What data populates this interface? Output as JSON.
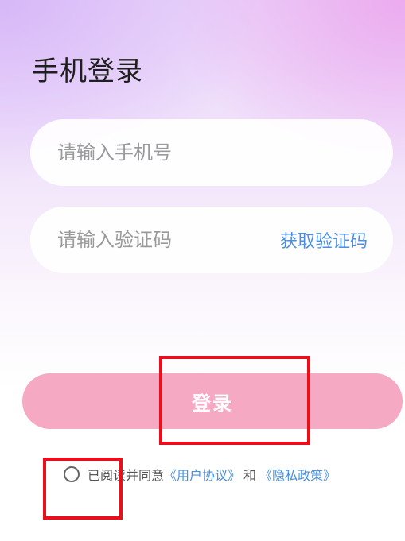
{
  "header": {
    "title": "手机登录"
  },
  "form": {
    "phone_placeholder": "请输入手机号",
    "code_placeholder": "请输入验证码",
    "get_code_label": "获取验证码",
    "login_label": "登录"
  },
  "agreement": {
    "prefix": "已阅读并同意",
    "user_agreement": "《用户协议》",
    "conjunction": "和",
    "privacy_policy": "《隐私政策》",
    "checked": false
  },
  "colors": {
    "accent_link": "#4a8fe0",
    "login_button": "#f5a9c3",
    "highlight_box": "#e8101c"
  }
}
